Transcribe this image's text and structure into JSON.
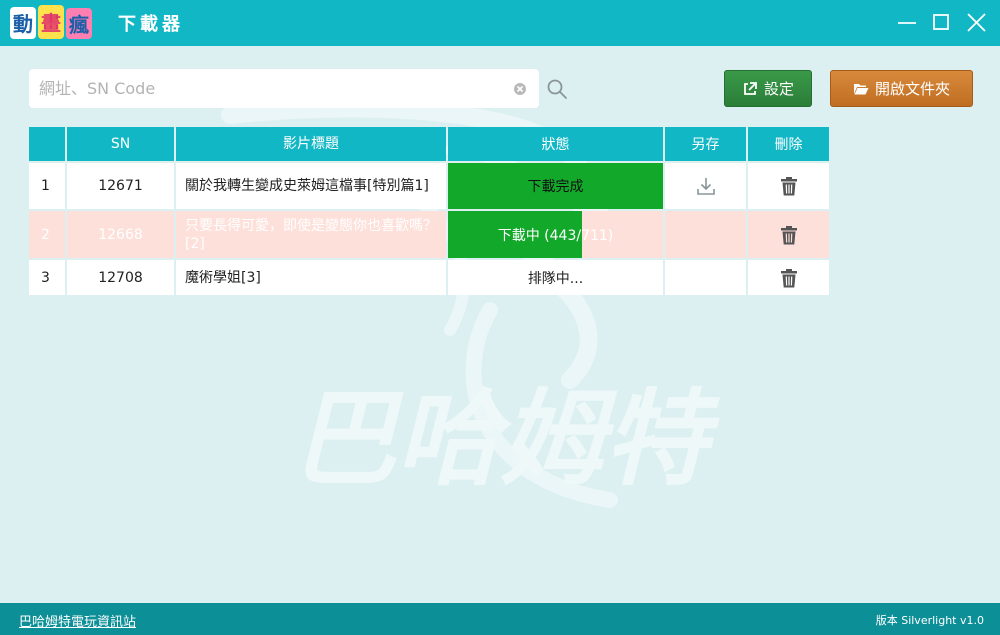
{
  "window": {
    "logo_text": "動畫瘋",
    "title": "下載器"
  },
  "search": {
    "value": "",
    "placeholder": "網址、SN Code"
  },
  "toolbar": {
    "settings_label": "設定",
    "open_folder_label": "開啟文件夾"
  },
  "table": {
    "headers": {
      "idx": "",
      "sn": "SN",
      "title": "影片標題",
      "status": "狀態",
      "save": "另存",
      "delete": "刪除"
    },
    "rows": [
      {
        "idx": "1",
        "sn": "12671",
        "title": "關於我轉生變成史萊姆這檔事[特別篇1]",
        "status": "下載完成",
        "progress": 1.0
      },
      {
        "idx": "2",
        "sn": "12668",
        "title": "只要長得可愛，即使是變態你也喜歡嗎？[2]",
        "status": "下載中 (443/711)",
        "progress": 0.623
      },
      {
        "idx": "3",
        "sn": "12708",
        "title": "魔術學姐[3]",
        "status": "排隊中...",
        "progress": 0
      }
    ]
  },
  "watermark_text": "巴哈姆特",
  "footer": {
    "link": "巴哈姆特電玩資訊站",
    "version": "版本 Silverlight v1.0"
  },
  "colors": {
    "accent": "#12b7c6",
    "progress": "#12a92b",
    "settings_button": "#2b7d38",
    "folder_button": "#bf6d22",
    "footer": "#0d8f97",
    "highlight_row": "#fde0da"
  }
}
